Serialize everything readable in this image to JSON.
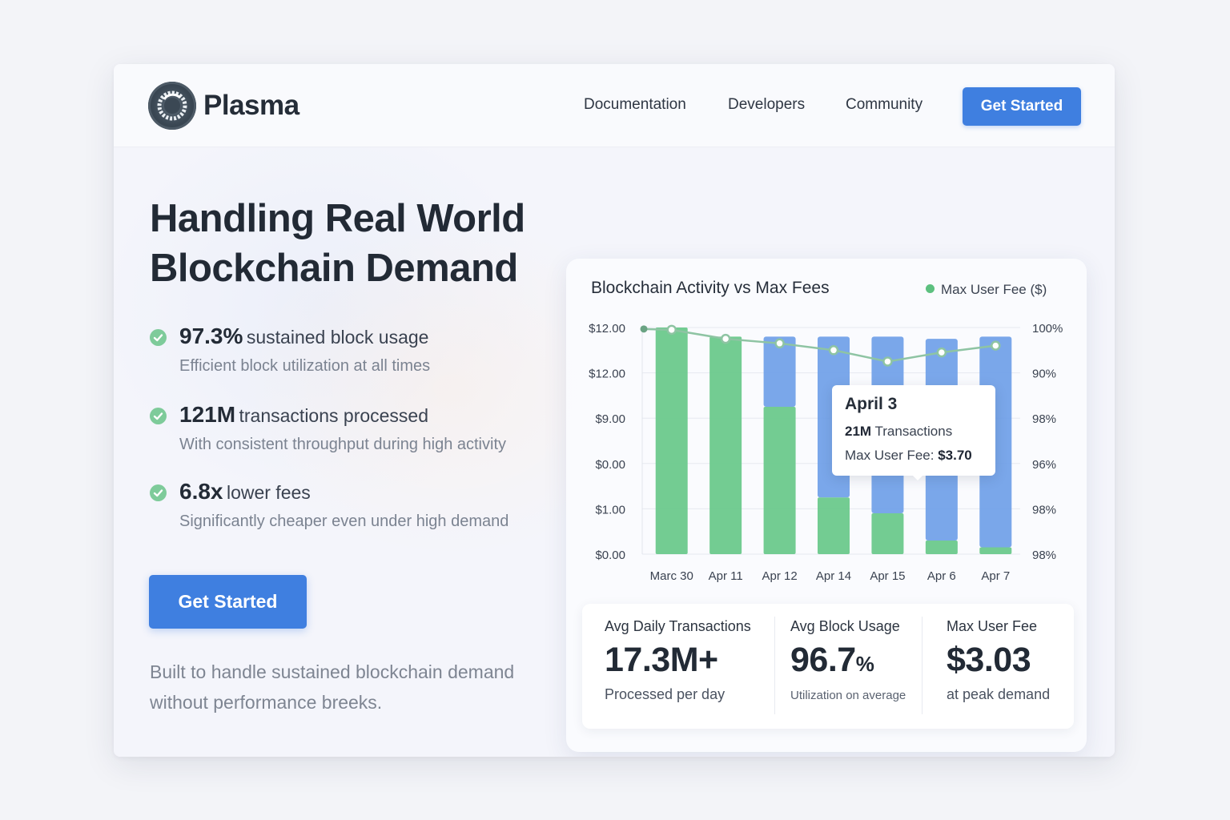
{
  "brand": {
    "name": "Plasma"
  },
  "nav": {
    "links": [
      "Documentation",
      "Developers",
      "Community"
    ],
    "cta": "Get Started"
  },
  "hero": {
    "headline": "Handling Real World Blockchain Demand",
    "features": [
      {
        "num": "97.3%",
        "label": "sustained block usage",
        "sub": "Efficient block utilization at all times"
      },
      {
        "num": "121M",
        "label": "transactions processed",
        "sub": "With consistent throughput during high activity"
      },
      {
        "num": "6.8x",
        "label": "lower fees",
        "sub": "Significantly cheaper even under high demand"
      }
    ],
    "cta": "Get Started",
    "footnote": "Built to handle sustained blockchain demand without performance breeks."
  },
  "chart_data": {
    "type": "bar",
    "title": "Blockchain Activity vs Max Fees",
    "legend": [
      {
        "name": "Max User Fee ($)",
        "color": "#5cc07f"
      }
    ],
    "legend_position": "top-right",
    "categories": [
      "Marc 30",
      "Apr 11",
      "Apr 12",
      "Apr 14",
      "Apr 15",
      "Apr 6",
      "Apr 7"
    ],
    "y_left_ticks": [
      "$12.00",
      "$12.00",
      "$9.00",
      "$0.00",
      "$1.00",
      "$0.00"
    ],
    "y_right_ticks": [
      "100%",
      "90%",
      "98%",
      "96%",
      "98%",
      "98%"
    ],
    "series": [
      {
        "values": [
          1.0,
          0.96,
          0.65,
          0.25,
          0.18,
          0.06,
          0.03
        ],
        "color": "#6cc98c"
      },
      {
        "values": [
          0.0,
          0.0,
          0.31,
          0.71,
          0.78,
          0.89,
          0.93
        ],
        "color": "#6f9fe8"
      },
      {
        "name": "Max User Fee ($)",
        "values": [
          0.99,
          0.95,
          0.93,
          0.9,
          0.85,
          0.89,
          0.92
        ],
        "color": "#8ec4a3"
      }
    ],
    "ylim": [
      0,
      1
    ],
    "grid": true,
    "tooltip": {
      "title": "April 3",
      "transactions_value": "21M",
      "transactions_label": "Transactions",
      "fee_label": "Max User Fee:",
      "fee_value": "$3.70"
    }
  },
  "stats": [
    {
      "label": "Avg Daily Transactions",
      "value": "17.3M+",
      "unit": "",
      "sub": "Processed per day"
    },
    {
      "label": "Avg Block Usage",
      "value": "96.7",
      "unit": "%",
      "sub": "Utilization on average"
    },
    {
      "label": "Max User Fee",
      "value": "$3.03",
      "unit": "",
      "sub": "at peak demand"
    }
  ],
  "colors": {
    "accent": "#3f7fe0",
    "check": "#7ecb9a",
    "bar_green": "#6cc98c",
    "bar_blue": "#6f9fe8"
  }
}
